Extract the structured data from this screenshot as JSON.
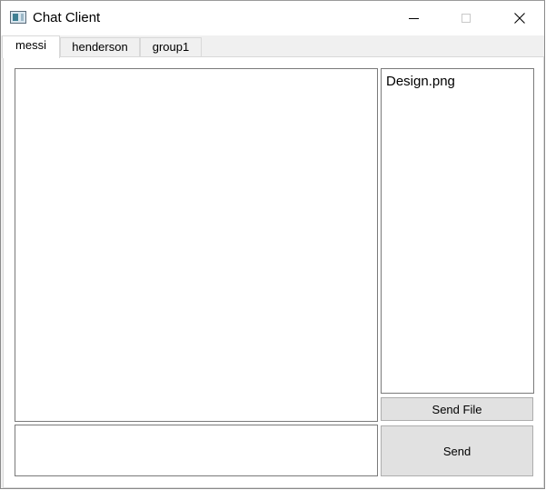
{
  "window": {
    "title": "Chat Client"
  },
  "tabs": [
    {
      "label": "messi",
      "active": true
    },
    {
      "label": "henderson",
      "active": false
    },
    {
      "label": "group1",
      "active": false
    }
  ],
  "files": {
    "items": [
      "Design.png"
    ]
  },
  "buttons": {
    "send_file": "Send File",
    "send": "Send"
  },
  "message_input": {
    "value": ""
  }
}
